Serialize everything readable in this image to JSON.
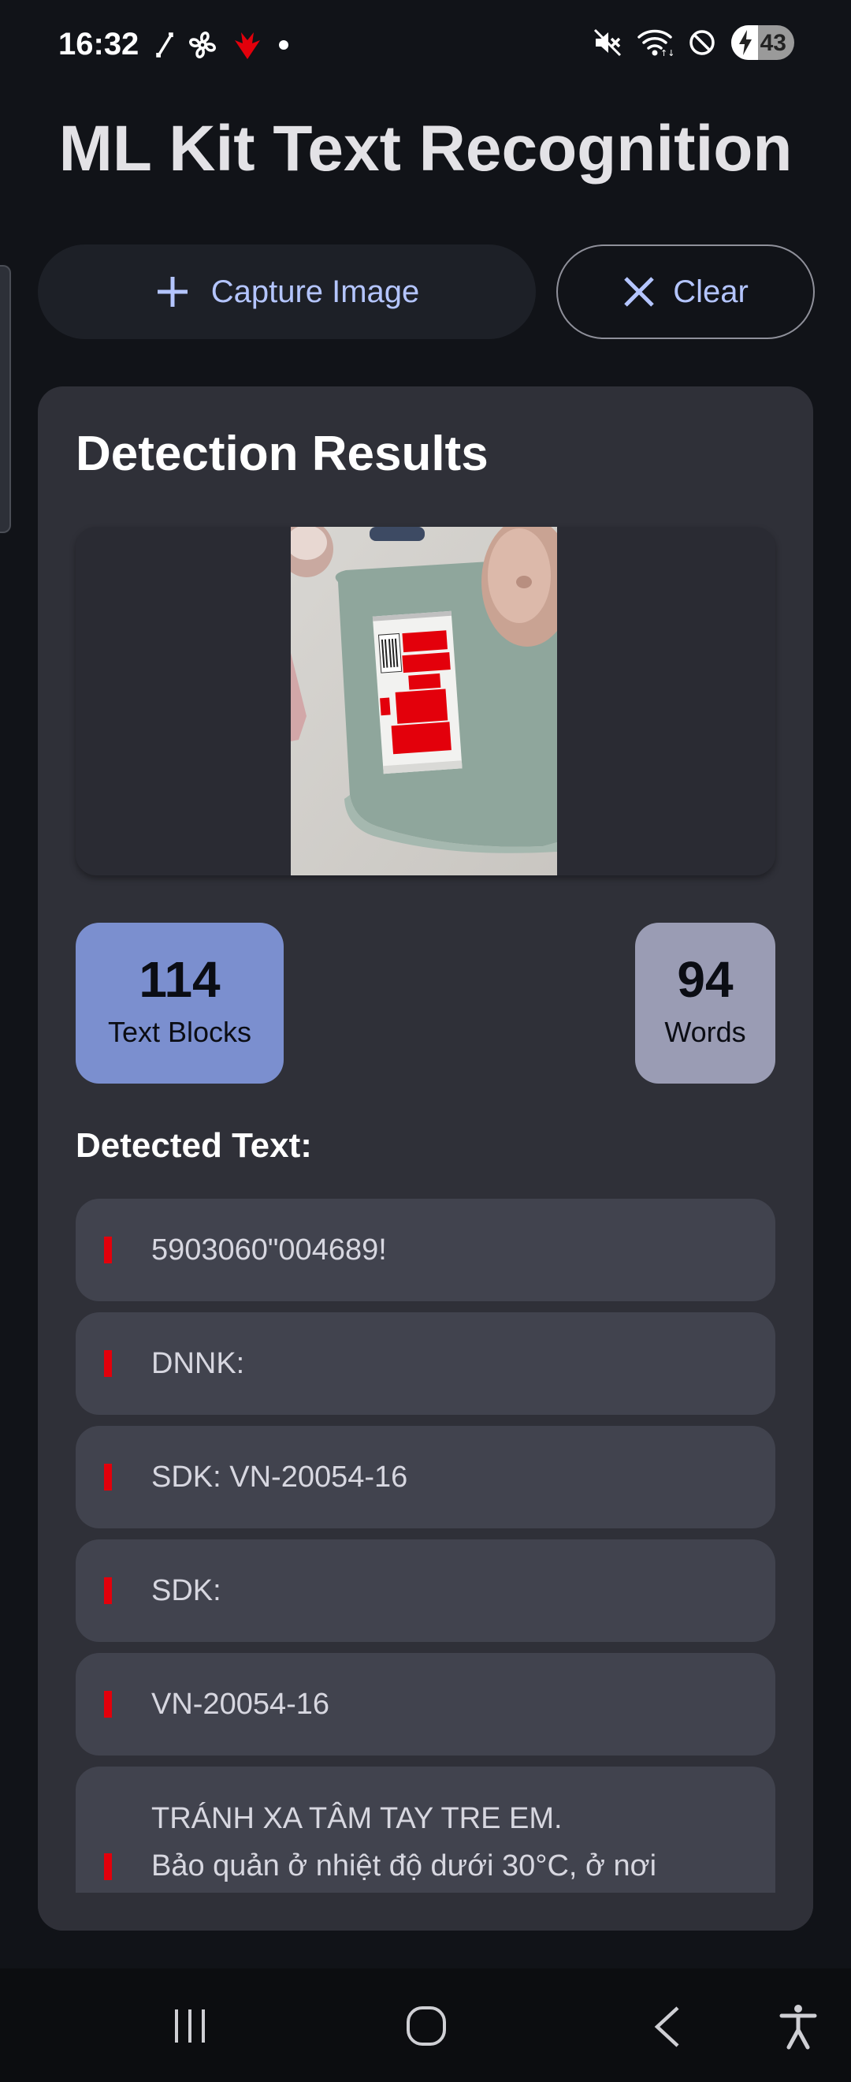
{
  "status_bar": {
    "time": "16:32",
    "battery": "43",
    "left_icons": [
      "arrows-icon",
      "fan-icon",
      "app-red-icon",
      "dot-icon"
    ],
    "right_icons": [
      "mute-icon",
      "wifi-icon",
      "dnd-icon",
      "battery-icon"
    ]
  },
  "app": {
    "title": "ML Kit Text Recognition"
  },
  "actions": {
    "capture_label": "Capture Image",
    "clear_label": "Clear"
  },
  "results": {
    "title": "Detection Results",
    "text_blocks_count": "114",
    "text_blocks_label": "Text Blocks",
    "words_count": "94",
    "words_label": "Words",
    "detected_heading": "Detected Text:",
    "items": [
      "5903060\"004689!",
      "DNNK:",
      "SDK: VN-20054-16",
      "SDK:",
      "VN-20054-16",
      "TRÁNH XA TÂM TAY TRE EM.\nBảo quản ở nhiệt độ dưới 30°C, ở nơi"
    ]
  },
  "colors": {
    "background": "#111318",
    "card": "#2f3038",
    "accent": "#b4c5ff",
    "blocks_chip": "#7b8fcf",
    "words_chip": "#9a9cb4",
    "highlight_bar": "#e3000b"
  }
}
